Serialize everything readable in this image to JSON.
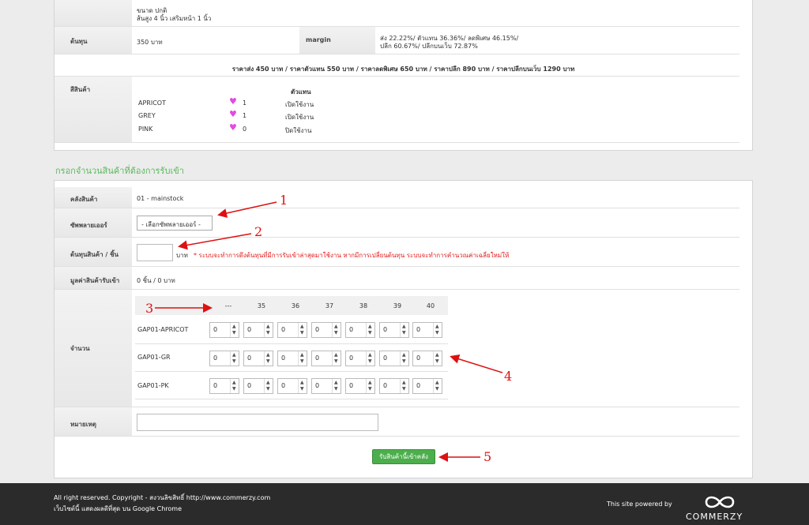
{
  "product": {
    "size_line1": "ขนาด ปกติ",
    "size_line2": "ส้นสูง 4 นิ้ว เสริมหน้า 1 นิ้ว",
    "cost_label": "ต้นทุน",
    "cost_value": "350 บาท",
    "margin_label": "margin",
    "margin_line1": "ส่ง 22.22%/ ตัวแทน 36.36%/ ลดพิเศษ 46.15%/",
    "margin_line2": "ปลีก 60.67%/ ปลีกบนเว็บ 72.87%",
    "prices_line": "ราคาส่ง 450 บาท / ราคาตัวแทน 550 บาท / ราคาลดพิเศษ 650 บาท / ราคาปลีก 890 บาท / ราคาปลีกบนเว็บ 1290 บาท",
    "colors_label": "สีสินค้า",
    "agent_header": "ตัวแทน",
    "colors": [
      {
        "name": "APRICOT",
        "count": "1",
        "status": "เปิดใช้งาน"
      },
      {
        "name": "GREY",
        "count": "1",
        "status": "เปิดใช้งาน"
      },
      {
        "name": "PINK",
        "count": "0",
        "status": "ปิดใช้งาน"
      }
    ],
    "heart_icon": "♥"
  },
  "form": {
    "section_title": "กรอกจำนวนสินค้าที่ต้องการรับเข้า",
    "warehouse_label": "คลังสินค้า",
    "warehouse_value": "01 - mainstock",
    "supplier_label": "ซัพพลายเออร์",
    "supplier_selected": "- เลือกซัพพลายเออร์ -",
    "unit_cost_label": "ต้นทุนสินค้า / ชิ้น",
    "unit_cost_value": "",
    "unit_text": "บาท",
    "note_text": "* ระบบจะทำการดึงต้นทุนที่มีการรับเข้าล่าสุดมาใช้งาน หากมีการเปลี่ยนต้นทุน ระบบจะทำการคำนวณค่าเฉลี่ยใหม่ให้",
    "value_label": "มูลค่าสินค้ารับเข้า",
    "value_text": "0 ชิ้น / 0 บาท",
    "qty_label": "จำนวน",
    "size_headers": [
      "---",
      "35",
      "36",
      "37",
      "38",
      "39",
      "40"
    ],
    "rows": [
      {
        "sku": "GAP01-APRICOT",
        "values": [
          "0",
          "0",
          "0",
          "0",
          "0",
          "0",
          "0"
        ]
      },
      {
        "sku": "GAP01-GR",
        "values": [
          "0",
          "0",
          "0",
          "0",
          "0",
          "0",
          "0"
        ]
      },
      {
        "sku": "GAP01-PK",
        "values": [
          "0",
          "0",
          "0",
          "0",
          "0",
          "0",
          "0"
        ]
      }
    ],
    "remark_label": "หมายเหตุ",
    "remark_value": "",
    "submit_label": "รับสินค้านี้เข้าคลัง"
  },
  "annotations": [
    "1",
    "2",
    "3",
    "4",
    "5"
  ],
  "colors": {
    "annotation": "#dd1111",
    "button": "#4cae4c",
    "section_title": "#5cb85c",
    "footer_bg": "#2b2b2b"
  },
  "footer": {
    "line1": "All right reserved. Copyright - สงวนลิขสิทธิ์ http://www.commerzy.com",
    "line2": "เว็บไซต์นี้ แสดงผลดีที่สุด บน Google Chrome",
    "powered": "This site powered by",
    "brand": "COMMERZY",
    "logo_icon": "infinity-icon"
  }
}
